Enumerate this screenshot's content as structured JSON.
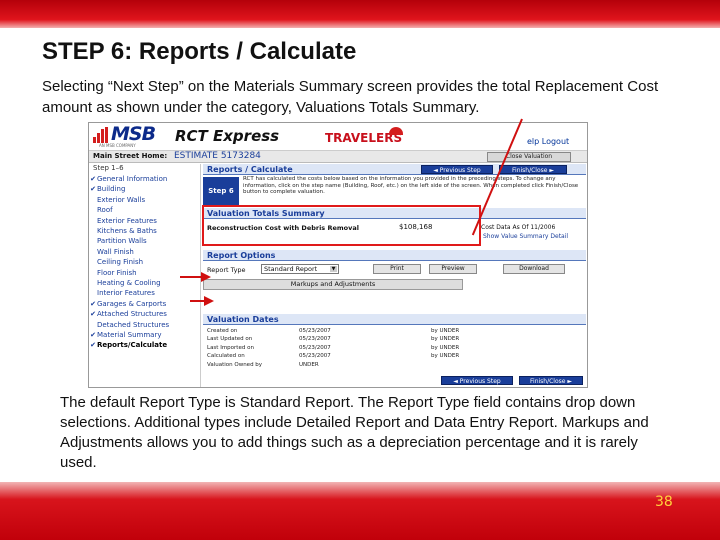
{
  "slide": {
    "title": "STEP 6:  Reports / Calculate",
    "intro": "Selecting “Next Step” on the Materials Summary screen provides the total Replacement Cost amount as shown under the category, Valuations Totals Summary.",
    "note": "The default Report Type is Standard Report. The Report Type field contains drop down selections. Additional types include Detailed Report and Data Entry Report. Markups and Adjustments allows you to add things such as a depreciation percentage and it is rarely used.",
    "page_number": "38",
    "colors": {
      "band_red": "#d8141c",
      "page_number": "#ffd23c",
      "highlight": "#e01a1a"
    }
  },
  "screenshot": {
    "logo": "MSB",
    "logo_sub": "AN MSB COMPANY",
    "app_name": "RCT Express",
    "partner": "TRAVELERS",
    "top_links": "elp    Logout",
    "home_label": "Main Street Home:",
    "estimate": "ESTIMATE 5173284",
    "home_button": "Close Valuation",
    "nav_heading": "Step 1–6",
    "nav_items": [
      {
        "label": "General Information",
        "checked": true
      },
      {
        "label": "Building",
        "checked": true
      },
      {
        "label": "Exterior Walls",
        "checked": false
      },
      {
        "label": "Roof",
        "checked": false
      },
      {
        "label": "Exterior Features",
        "checked": false
      },
      {
        "label": "Kitchens & Baths",
        "checked": false
      },
      {
        "label": "Partition Walls",
        "checked": false
      },
      {
        "label": "Wall Finish",
        "checked": false
      },
      {
        "label": "Ceiling Finish",
        "checked": false
      },
      {
        "label": "Floor Finish",
        "checked": false
      },
      {
        "label": "Heating & Cooling",
        "checked": false
      },
      {
        "label": "Interior Features",
        "checked": false
      },
      {
        "label": "Garages & Carports",
        "checked": true
      },
      {
        "label": "Attached Structures",
        "checked": true
      },
      {
        "label": "Detached Structures",
        "checked": false
      },
      {
        "label": "Material Summary",
        "checked": true
      },
      {
        "label": "Reports/Calculate",
        "checked": true
      }
    ],
    "check_glyph": "✔",
    "reports_title": "Reports / Calculate",
    "previous_step": "◄ Previous Step",
    "finish_close": "Finish/Close ►",
    "step_label": "Step 6",
    "step_description": "RCT has calculated the costs below based on the information you provided in the preceding steps. To change any information, click on the step name (Building, Roof, etc.) on the left side of the screen. When completed click Finish/Close button to complete valuation.",
    "valuation_title": "Valuation Totals Summary",
    "reconstruction_label": "Reconstruction Cost with Debris Removal",
    "reconstruction_value": "$108,168",
    "cost_date": "Cost Data As Of 11/2006",
    "value_details_link": "Show Value Summary Detail",
    "report_options_title": "Report Options",
    "report_type_label": "Report Type",
    "report_type_value": "Standard Report",
    "print_button": "Print",
    "preview_button": "Preview",
    "download_button": "Download",
    "markups_button": "Markups and Adjustments",
    "valuation_dates_title": "Valuation Dates",
    "dates": [
      {
        "label": "Created on",
        "date": "05/23/2007",
        "by": "by UNDER"
      },
      {
        "label": "Last Updated on",
        "date": "05/23/2007",
        "by": "by UNDER"
      },
      {
        "label": "Last Imported on",
        "date": "05/23/2007",
        "by": "by UNDER"
      },
      {
        "label": "Calculated on",
        "date": "05/23/2007",
        "by": "by UNDER"
      },
      {
        "label": "Valuation Owned by",
        "date": "UNDER",
        "by": ""
      }
    ]
  }
}
